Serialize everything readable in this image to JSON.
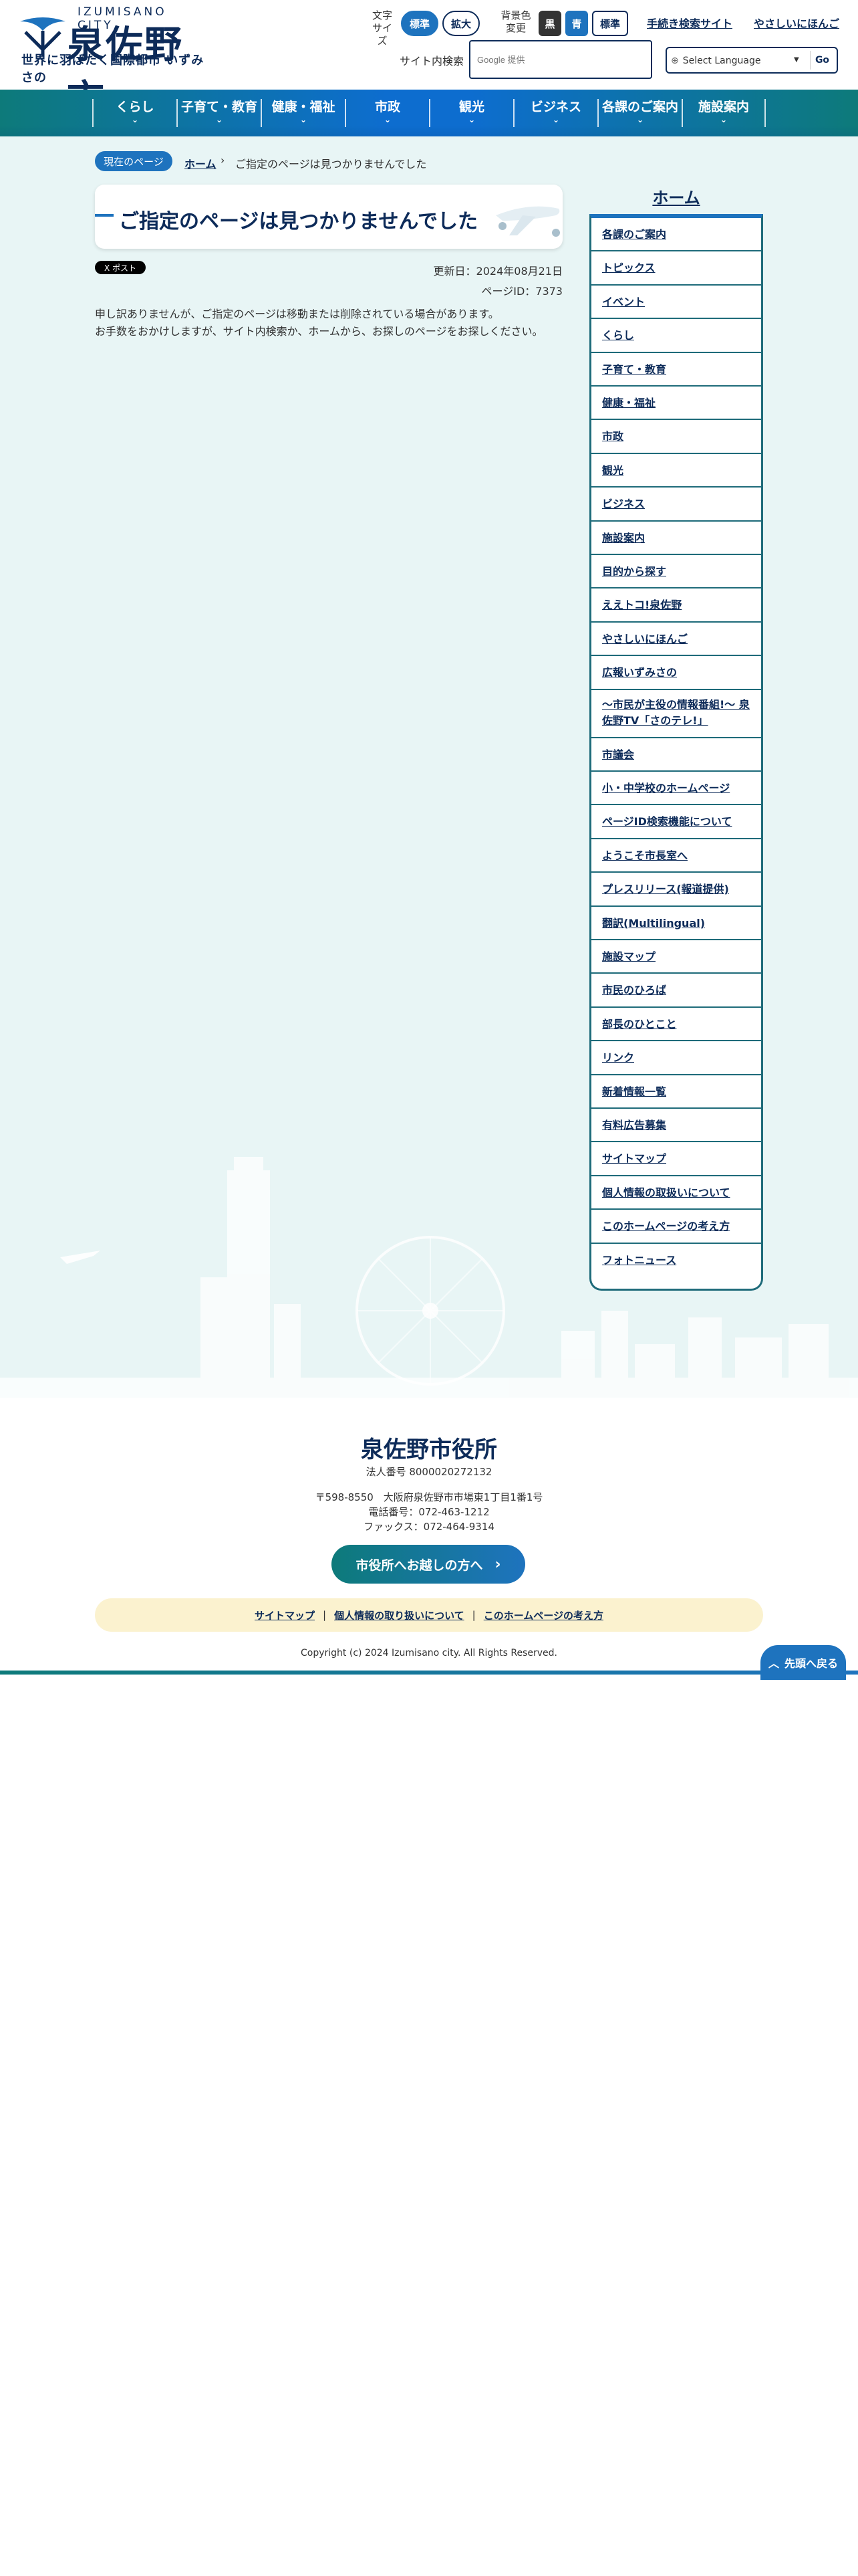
{
  "header": {
    "logo_en": "IZUMISANO CITY",
    "logo_jp": "泉佐野市",
    "logo_sub": "世界に羽ばたく国際都市 いずみさの",
    "font_size_label": [
      "文字",
      "サイズ"
    ],
    "font_size_options": [
      "標準",
      "拡大"
    ],
    "bg_color_label": [
      "背景色",
      "変更"
    ],
    "bg_color_options": [
      "黒",
      "青",
      "標準"
    ],
    "links": [
      "手続き検索サイト",
      "やさしいにほんご"
    ],
    "search_label": "サイト内検索",
    "search_placeholder": "Google 提供",
    "language_select": "Select Language",
    "language_go": "Go"
  },
  "nav": [
    "くらし",
    "子育て・教育",
    "健康・福祉",
    "市政",
    "観光",
    "ビジネス",
    "各課のご案内",
    "施設案内"
  ],
  "breadcrumb": {
    "badge": "現在のページ",
    "home": "ホーム",
    "current": "ご指定のページは見つかりませんでした"
  },
  "page": {
    "title": "ご指定のページは見つかりませんでした",
    "share": "X ポスト",
    "updated": "更新日：2024年08月21日",
    "page_id": "ページID：7373",
    "message_1": "申し訳ありませんが、ご指定のページは移動または削除されている場合があります。",
    "message_2": "お手数をおかけしますが、サイト内検索か、ホームから、お探しのページをお探しください。"
  },
  "sidebar": {
    "title": "ホーム",
    "items": [
      "各課のご案内",
      "トピックス",
      "イベント",
      "くらし",
      "子育て・教育",
      "健康・福祉",
      "市政",
      "観光",
      "ビジネス",
      "施設案内",
      "目的から探す",
      "ええトコ!泉佐野",
      "やさしいにほんご",
      "広報いずみさの",
      "～市民が主役の情報番組!～ 泉佐野TV「さのテレ!」",
      "市議会",
      "小・中学校のホームページ",
      "ページID検索機能について",
      "ようこそ市長室へ",
      "プレスリリース(報道提供)",
      "翻訳(Multilingual)",
      "施設マップ",
      "市民のひろば",
      "部長のひとこと",
      "リンク",
      "新着情報一覧",
      "有料広告募集",
      "サイトマップ",
      "個人情報の取扱いについて",
      "このホームページの考え方",
      "フォトニュース"
    ]
  },
  "footer": {
    "name": "泉佐野市役所",
    "corp_no": "法人番号 8000020272132",
    "address": "〒598-8550　大阪府泉佐野市市場東1丁目1番1号",
    "tel": "電話番号：072-463-1212",
    "fax": "ファックス：072-464-9314",
    "visit_button": "市役所へお越しの方へ",
    "links": [
      "サイトマップ",
      "個人情報の取り扱いについて",
      "このホームページの考え方"
    ],
    "copyright": "Copyright (c) 2024 Izumisano city. All Rights Reserved.",
    "to_top": "先頭へ戻る"
  },
  "colors": {
    "navy": "#0d2b59",
    "blue": "#1e73be",
    "teal": "#0d7a7a",
    "bg_light": "#e8f5f5",
    "footer_link_bg": "#fbf2cf"
  }
}
